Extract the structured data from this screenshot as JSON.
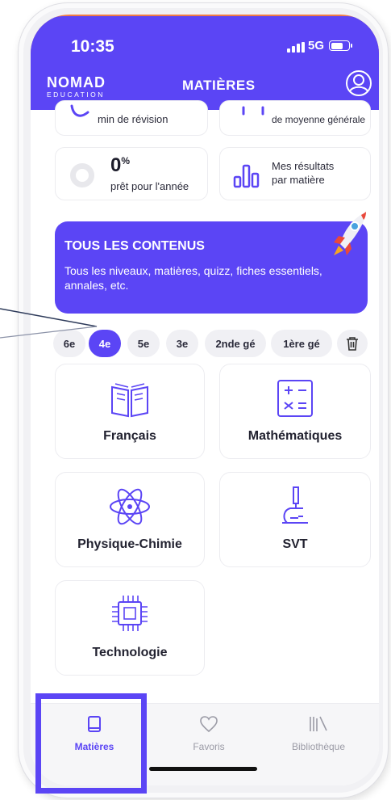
{
  "status_bar": {
    "time": "10:35",
    "network": "5G"
  },
  "header": {
    "logo_main": "NOMAD",
    "logo_sub": "EDUCATION",
    "title": "MATIÈRES",
    "profile_icon": "user-circle-icon"
  },
  "stats": {
    "revision_text": "min de révision",
    "average_text": "de moyenne générale",
    "progress_value": "0",
    "progress_unit": "%",
    "progress_label": "prêt pour l'année",
    "results_label_line1": "Mes résultats",
    "results_label_line2": "par matière"
  },
  "banner": {
    "title": "TOUS LES CONTENUS",
    "description": "Tous les niveaux, matières, quizz, fiches essentiels, annales, etc."
  },
  "levels": {
    "items": [
      "6e",
      "4e",
      "5e",
      "3e",
      "2nde gé",
      "1ère gé"
    ],
    "selected": "4e"
  },
  "subjects": [
    {
      "label": "Français",
      "icon": "book-icon"
    },
    {
      "label": "Mathématiques",
      "icon": "calculator-icon"
    },
    {
      "label": "Physique-Chimie",
      "icon": "atom-icon"
    },
    {
      "label": "SVT",
      "icon": "microscope-icon"
    },
    {
      "label": "Technologie",
      "icon": "chip-icon"
    }
  ],
  "tabbar": {
    "items": [
      {
        "label": "Matières",
        "icon": "book-icon",
        "active": true
      },
      {
        "label": "Favoris",
        "icon": "heart-icon",
        "active": false
      },
      {
        "label": "Bibliothèque",
        "icon": "library-icon",
        "active": false
      }
    ]
  },
  "colors": {
    "accent": "#5b45f5",
    "top_edge": "#f07b45",
    "icon_stroke": "#5b45f5"
  }
}
